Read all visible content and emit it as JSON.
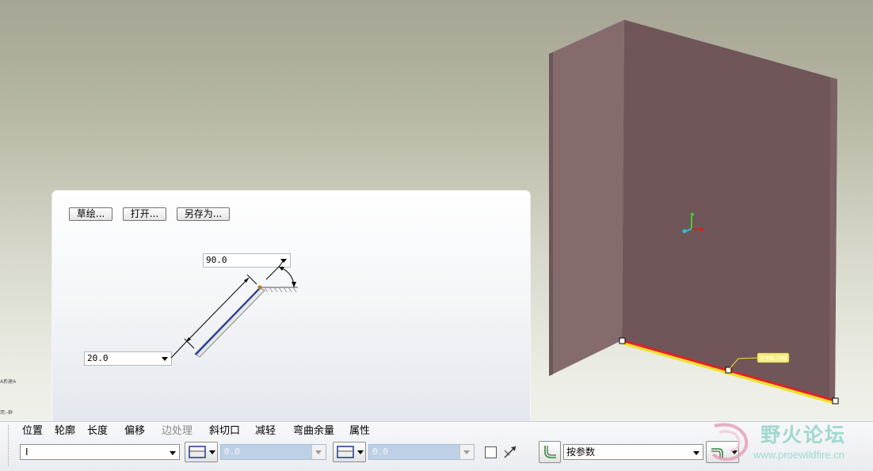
{
  "side_notes": [
    "A新建A",
    "用:-群"
  ],
  "profile_panel": {
    "buttons": [
      "草绘...",
      "打开...",
      "另存为..."
    ],
    "angle_value": "90.0",
    "length_value": "20.0"
  },
  "model": {
    "callout": "在平面, 内侧"
  },
  "dashboard": {
    "tabs": [
      "位置",
      "轮廓",
      "长度",
      "偏移",
      "边处理",
      "斜切口",
      "减轻",
      "弯曲余量",
      "属性"
    ],
    "shape_select": "I",
    "offset_1": "0.0",
    "offset_2": "0.0",
    "bend_mode": "按参数"
  },
  "watermark": {
    "title": "野火论坛",
    "url": "www.proewildfire.cn"
  },
  "colors": {
    "wall_front": "#6f5558",
    "wall_side": "#856a6c",
    "edge_red": "#e0202a",
    "edge_yellow": "#f2e02a",
    "disabled_field": "#bdd0e6"
  }
}
